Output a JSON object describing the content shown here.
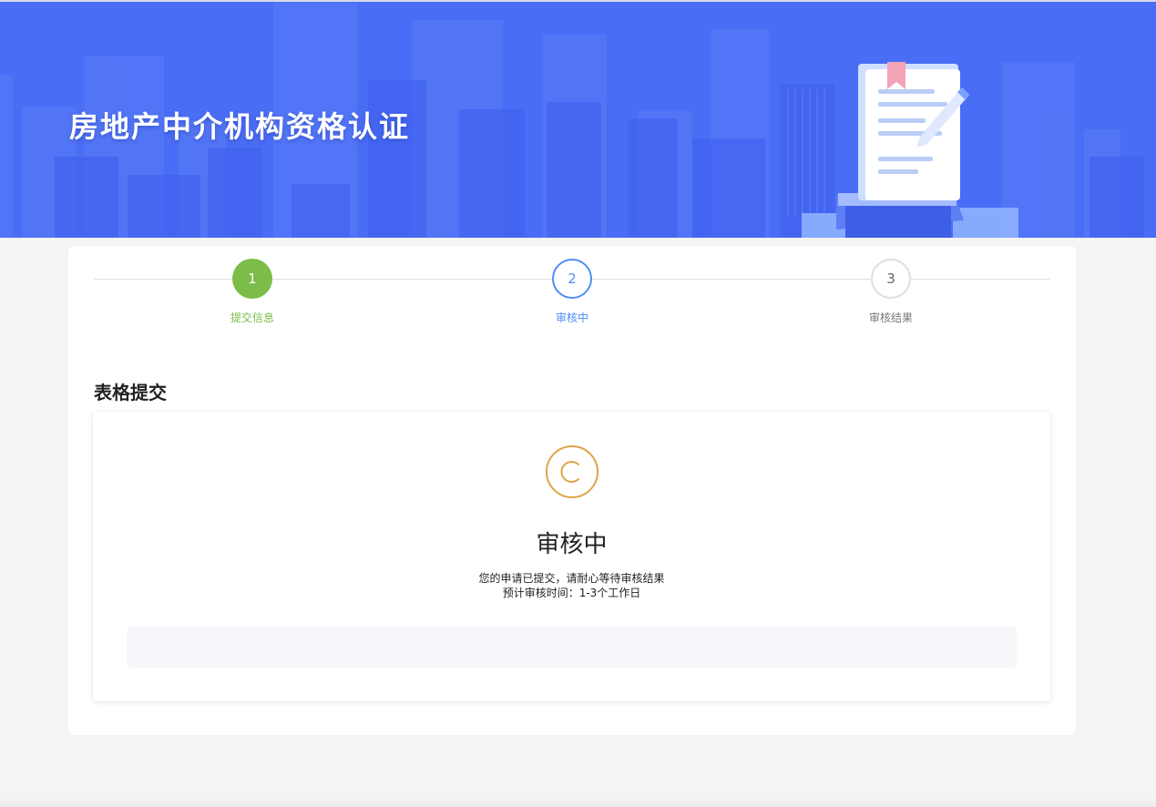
{
  "banner": {
    "title": "房地产中介机构资格认证",
    "background_color": "#4a6df5",
    "illustration": "document-with-pen-icon"
  },
  "steps": [
    {
      "number": "1",
      "label": "提交信息",
      "state": "completed",
      "color": "#7bbd48"
    },
    {
      "number": "2",
      "label": "审核中",
      "state": "active",
      "color": "#4e8ef7"
    },
    {
      "number": "3",
      "label": "审核结果",
      "state": "pending",
      "color": "#777777"
    }
  ],
  "section": {
    "title": "表格提交"
  },
  "status": {
    "icon": "pending-clock-icon",
    "icon_color": "#e0a448",
    "title": "审核中",
    "line1": "您的申请已提交，请耐心等待审核结果",
    "line2": "预计审核时间：1-3个工作日"
  }
}
